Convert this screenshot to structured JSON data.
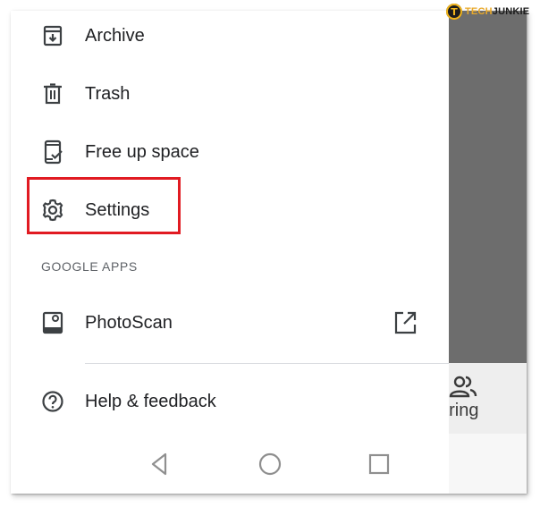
{
  "drawer": {
    "items": [
      {
        "label": "Archive",
        "icon": "archive-icon"
      },
      {
        "label": "Trash",
        "icon": "trash-icon"
      },
      {
        "label": "Free up space",
        "icon": "free-up-space-icon"
      },
      {
        "label": "Settings",
        "icon": "settings-icon"
      }
    ],
    "section_header": "GOOGLE APPS",
    "apps": [
      {
        "label": "PhotoScan",
        "icon": "photoscan-icon",
        "trailing_icon": "open-in-new-icon"
      }
    ],
    "footer_items": [
      {
        "label": "Help & feedback",
        "icon": "help-icon"
      }
    ]
  },
  "background_peek": {
    "label": "aring",
    "icon": "people-icon"
  },
  "nav_bar": {
    "buttons": [
      "back",
      "home",
      "recents"
    ]
  },
  "watermark": {
    "badge": "T",
    "text_a": "TECH",
    "text_b": "JUNKIE"
  },
  "colors": {
    "highlight": "#e11b22",
    "text": "#202124",
    "section_header": "#5f6368",
    "overlay": "#6d6d6d"
  }
}
